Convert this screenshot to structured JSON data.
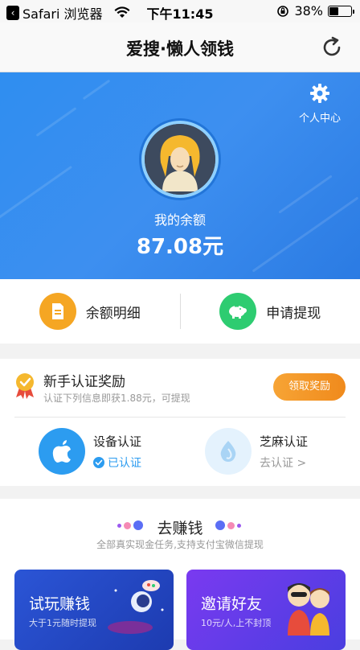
{
  "status_bar": {
    "back_app": "Safari 浏览器",
    "time": "下午11:45",
    "battery": "38%",
    "battery_level": 0.38
  },
  "nav": {
    "title": "爱搜·懒人领钱",
    "refresh_icon": "refresh-icon"
  },
  "hero": {
    "personal_center": "个人中心",
    "balance_label": "我的余额",
    "balance_value": "87.08元",
    "colors": {
      "bg_start": "#2f8ef0",
      "bg_end": "#2b7be3"
    }
  },
  "actions": [
    {
      "label": "余额明细",
      "icon": "document-icon",
      "color": "#f5a623"
    },
    {
      "label": "申请提现",
      "icon": "piggy-bank-icon",
      "color": "#2ecc71"
    }
  ],
  "verify": {
    "title": "新手认证奖励",
    "subtitle": "认证下列信息即获1.88元，可提现",
    "claim_button": "领取奖励",
    "items": [
      {
        "name": "设备认证",
        "state": "已认证",
        "icon": "apple-icon"
      },
      {
        "name": "芝麻认证",
        "state": "去认证 >",
        "icon": "sesame-icon"
      }
    ]
  },
  "earn": {
    "title": "去赚钱",
    "subtitle": "全部真实现金任务,支持支付宝微信提现",
    "cards": [
      {
        "title": "试玩赚钱",
        "subtitle": "大于1元随时提现"
      },
      {
        "title": "邀请好友",
        "subtitle": "10元/人,上不封顶"
      }
    ]
  }
}
